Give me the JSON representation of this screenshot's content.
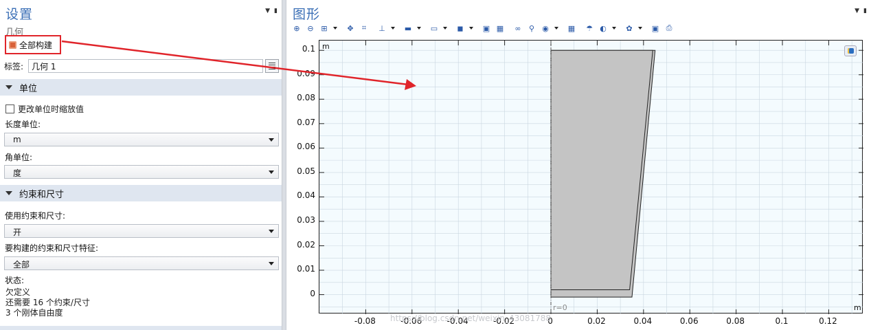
{
  "settings": {
    "title": "设置",
    "subtitle": "几何",
    "build_all_label": "全部构建",
    "tag_label": "标签:",
    "tag_value": "几何 1",
    "units_section": "单位",
    "scale_checkbox_label": "更改单位时缩放值",
    "length_unit_label": "长度单位:",
    "length_unit_value": "m",
    "angle_unit_label": "角单位:",
    "angle_unit_value": "度",
    "constraints_section": "约束和尺寸",
    "use_constraints_label": "使用约束和尺寸:",
    "use_constraints_value": "开",
    "build_features_label": "要构建的约束和尺寸特征:",
    "build_features_value": "全部",
    "status_label": "状态:",
    "status_lines": [
      "欠定义",
      "还需要 16 个约束/尺寸",
      "3 个刚体自由度"
    ]
  },
  "graphics": {
    "title": "图形",
    "toolbar_icons": [
      "zoom-in-icon",
      "zoom-out-icon",
      "zoom-box-icon",
      "zoom-extents-icon",
      "zoom-selected-icon",
      "axis-icon",
      "select-objects-icon",
      "select-domains-icon",
      "select-boundaries-icon",
      "select-all-icon",
      "clear-selection-icon",
      "hide-icon",
      "show-icon",
      "view-icon",
      "grid-icon",
      "lighting-icon",
      "render-icon",
      "scene-icon",
      "snapshot-icon",
      "print-icon"
    ],
    "y_unit": "m",
    "x_unit": "m",
    "r_zero_label": "r=0",
    "watermark": "https://blog.csdn.net/weixin_43081788",
    "colors": {
      "plot_bg": "#f4fbfe",
      "shape_fill": "#c4c4c4",
      "grid": "#c9d6e0",
      "arrow": "#e0242a"
    }
  },
  "chart_data": {
    "type": "geometry",
    "xlim": [
      -0.1,
      0.135
    ],
    "ylim": [
      -0.008,
      0.104
    ],
    "x_ticks": [
      -0.08,
      -0.06,
      -0.04,
      -0.02,
      0,
      0.02,
      0.04,
      0.06,
      0.08,
      0.1,
      0.12
    ],
    "y_ticks": [
      0,
      0.01,
      0.02,
      0.03,
      0.04,
      0.05,
      0.06,
      0.07,
      0.08,
      0.09,
      0.1
    ],
    "x_tick_labels": [
      "-0.08",
      "-0.06",
      "-0.04",
      "-0.02",
      "0",
      "0.02",
      "0.04",
      "0.06",
      "0.08",
      "0.1",
      "0.12"
    ],
    "y_tick_labels": [
      "0",
      "0.01",
      "0.02",
      "0.03",
      "0.04",
      "0.05",
      "0.06",
      "0.07",
      "0.08",
      "0.09",
      "0.1"
    ],
    "outer_polygon": [
      [
        0,
        -0.001
      ],
      [
        0.035,
        -0.001
      ],
      [
        0.045,
        0.1
      ],
      [
        0,
        0.1
      ]
    ],
    "inner_polygon": [
      [
        0,
        0.002
      ],
      [
        0.034,
        0.002
      ],
      [
        0.044,
        0.1
      ],
      [
        0,
        0.1
      ]
    ],
    "grid": true
  }
}
